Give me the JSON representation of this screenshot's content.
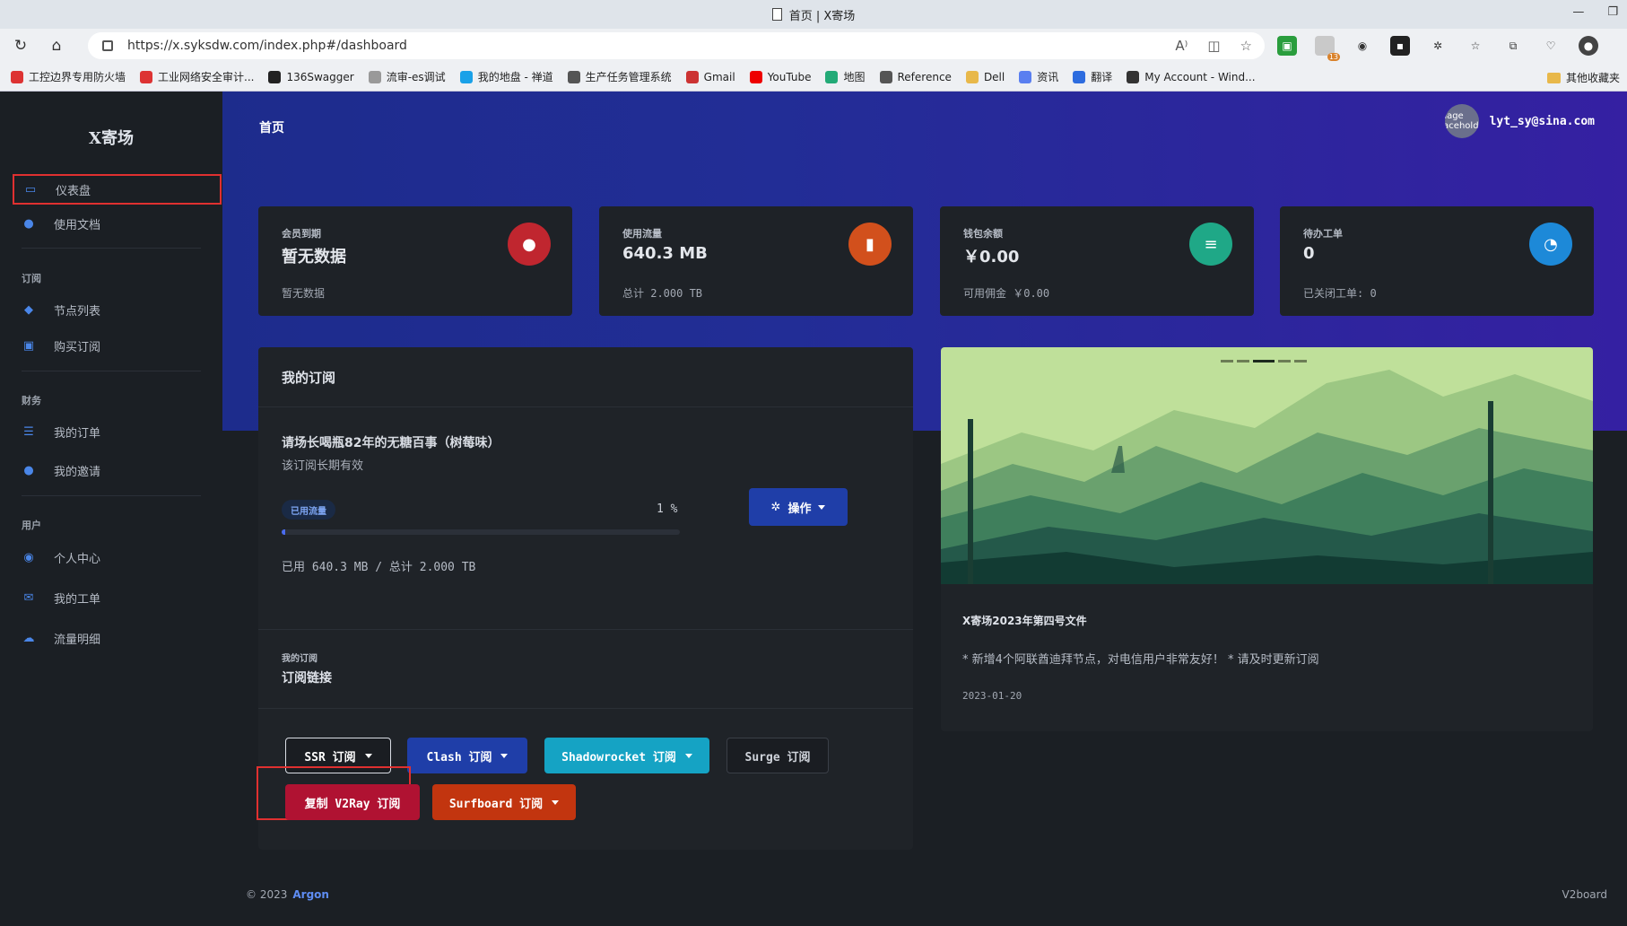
{
  "browser": {
    "tab_title": "首页 | X寄场",
    "url": "https://x.syksdw.com/index.php#/dashboard",
    "ext_badge": "13",
    "bookmarks": [
      "工控边界专用防火墙",
      "工业网络安全审计...",
      "136Swagger",
      "流审-es调试",
      "我的地盘 - 禅道",
      "生产任务管理系统",
      "Gmail",
      "YouTube",
      "地图",
      "Reference",
      "Dell",
      "资讯",
      "翻译",
      "My Account - Wind..."
    ],
    "other_bookmarks": "其他收藏夹"
  },
  "sidebar": {
    "brand": "X寄场",
    "items": [
      {
        "label": "仪表盘",
        "icon": "monitor-icon"
      },
      {
        "label": "使用文档",
        "icon": "bulb-icon"
      },
      {
        "section": "订阅"
      },
      {
        "label": "节点列表",
        "icon": "cube-icon"
      },
      {
        "label": "购买订阅",
        "icon": "cart-icon"
      },
      {
        "section": "财务"
      },
      {
        "label": "我的订单",
        "icon": "list-icon"
      },
      {
        "label": "我的邀请",
        "icon": "user-icon"
      },
      {
        "section": "用户"
      },
      {
        "label": "个人中心",
        "icon": "user-circle-icon"
      },
      {
        "label": "我的工单",
        "icon": "mail-icon"
      },
      {
        "label": "流量明细",
        "icon": "cloud-icon"
      }
    ]
  },
  "header": {
    "title": "首页",
    "avatar_alt": "Image Placeholder",
    "user_email": "lyt_sy@sina.com"
  },
  "stats": [
    {
      "label": "会员到期",
      "value": "暂无数据",
      "sub": "暂无数据",
      "icon": "user-icon",
      "color": "#c0262f"
    },
    {
      "label": "使用流量",
      "value": "640.3 MB",
      "sub": "总计 2.000 TB",
      "icon": "bar-chart-icon",
      "color": "#d2501c"
    },
    {
      "label": "钱包余额",
      "value": "￥0.00",
      "sub": "可用佣金 ￥0.00",
      "icon": "database-icon",
      "color": "#1fa887"
    },
    {
      "label": "待办工单",
      "value": "0",
      "sub": "已关闭工单: 0",
      "icon": "pie-icon",
      "color": "#1d89d8"
    }
  ],
  "subscription": {
    "title": "我的订阅",
    "plan_name": "请场长喝瓶82年的无糖百事（树莓味）",
    "plan_note": "该订阅长期有效",
    "usage_chip": "已用流量",
    "usage_percent": "1 %",
    "usage_fraction": 0.01,
    "usage_text": "已用 640.3 MB / 总计 2.000 TB",
    "op_label": "操作",
    "link_section": "我的订阅",
    "link_title": "订阅链接",
    "buttons": {
      "ssr": "SSR 订阅",
      "clash": "Clash 订阅",
      "shadowrocket": "Shadowrocket 订阅",
      "surge": "Surge 订阅",
      "v2ray": "复制 V2Ray 订阅",
      "surfboard": "Surfboard 订阅"
    }
  },
  "notice": {
    "title": "X寄场2023年第四号文件",
    "body": "* 新增4个阿联酋迪拜节点，对电信用户非常友好！ * 请及时更新订阅",
    "date": "2023-01-20"
  },
  "footer": {
    "copyright": "© 2023",
    "brand": "Argon",
    "right": "V2board"
  }
}
